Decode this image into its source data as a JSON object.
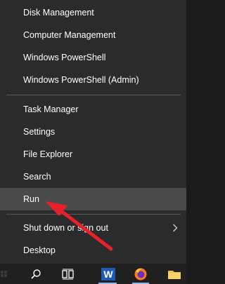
{
  "menu": {
    "items": [
      {
        "label": "Disk Management"
      },
      {
        "label": "Computer Management"
      },
      {
        "label": "Windows PowerShell"
      },
      {
        "label": "Windows PowerShell (Admin)"
      },
      {
        "label": "Task Manager"
      },
      {
        "label": "Settings"
      },
      {
        "label": "File Explorer"
      },
      {
        "label": "Search"
      },
      {
        "label": "Run"
      },
      {
        "label": "Shut down or sign out"
      },
      {
        "label": "Desktop"
      }
    ],
    "highlighted_item": "Run",
    "submenu_icon": "chevron-right-icon"
  },
  "taskbar": {
    "icons": [
      "search-icon",
      "task-view-icon",
      "word-icon",
      "firefox-icon",
      "file-explorer-icon"
    ],
    "word_label": "W"
  },
  "annotation": {
    "arrow_color": "#e8202a",
    "points_to": "Run"
  },
  "colors": {
    "menu_bg": "#2b2b2b",
    "hover_bg": "#4a4a4a",
    "text": "#ffffff"
  }
}
